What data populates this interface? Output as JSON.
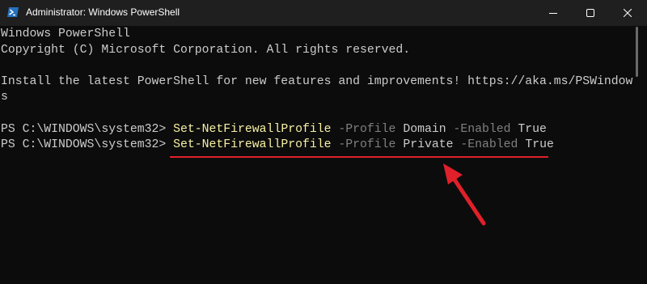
{
  "window": {
    "title": "Administrator: Windows PowerShell",
    "icon": "powershell-icon",
    "controls": [
      "minimize-icon",
      "maximize-icon",
      "close-icon"
    ]
  },
  "console": {
    "banner": "Windows PowerShell",
    "copyright": "Copyright (C) Microsoft Corporation. All rights reserved.",
    "install_line1": "Install the latest PowerShell for new features and improvements! https://aka.ms/PSWindow",
    "install_line2": "s",
    "commands": [
      {
        "prompt": "PS C:\\WINDOWS\\system32> ",
        "cmdlet": "Set-NetFirewallProfile",
        "profile_param": "-Profile",
        "profile_value": "Domain",
        "enabled_param": "-Enabled",
        "enabled_value": "True"
      },
      {
        "prompt": "PS C:\\WINDOWS\\system32> ",
        "cmdlet": "Set-NetFirewallProfile",
        "profile_param": "-Profile",
        "profile_value": "Private",
        "enabled_param": "-Enabled",
        "enabled_value": "True"
      }
    ]
  },
  "colors": {
    "background": "#0c0c0c",
    "titlebar": "#1f1f1f",
    "text": "#cccccc",
    "cmdlet": "#f9f1a5",
    "parameter": "#808080",
    "annotation": "#e0202a"
  }
}
